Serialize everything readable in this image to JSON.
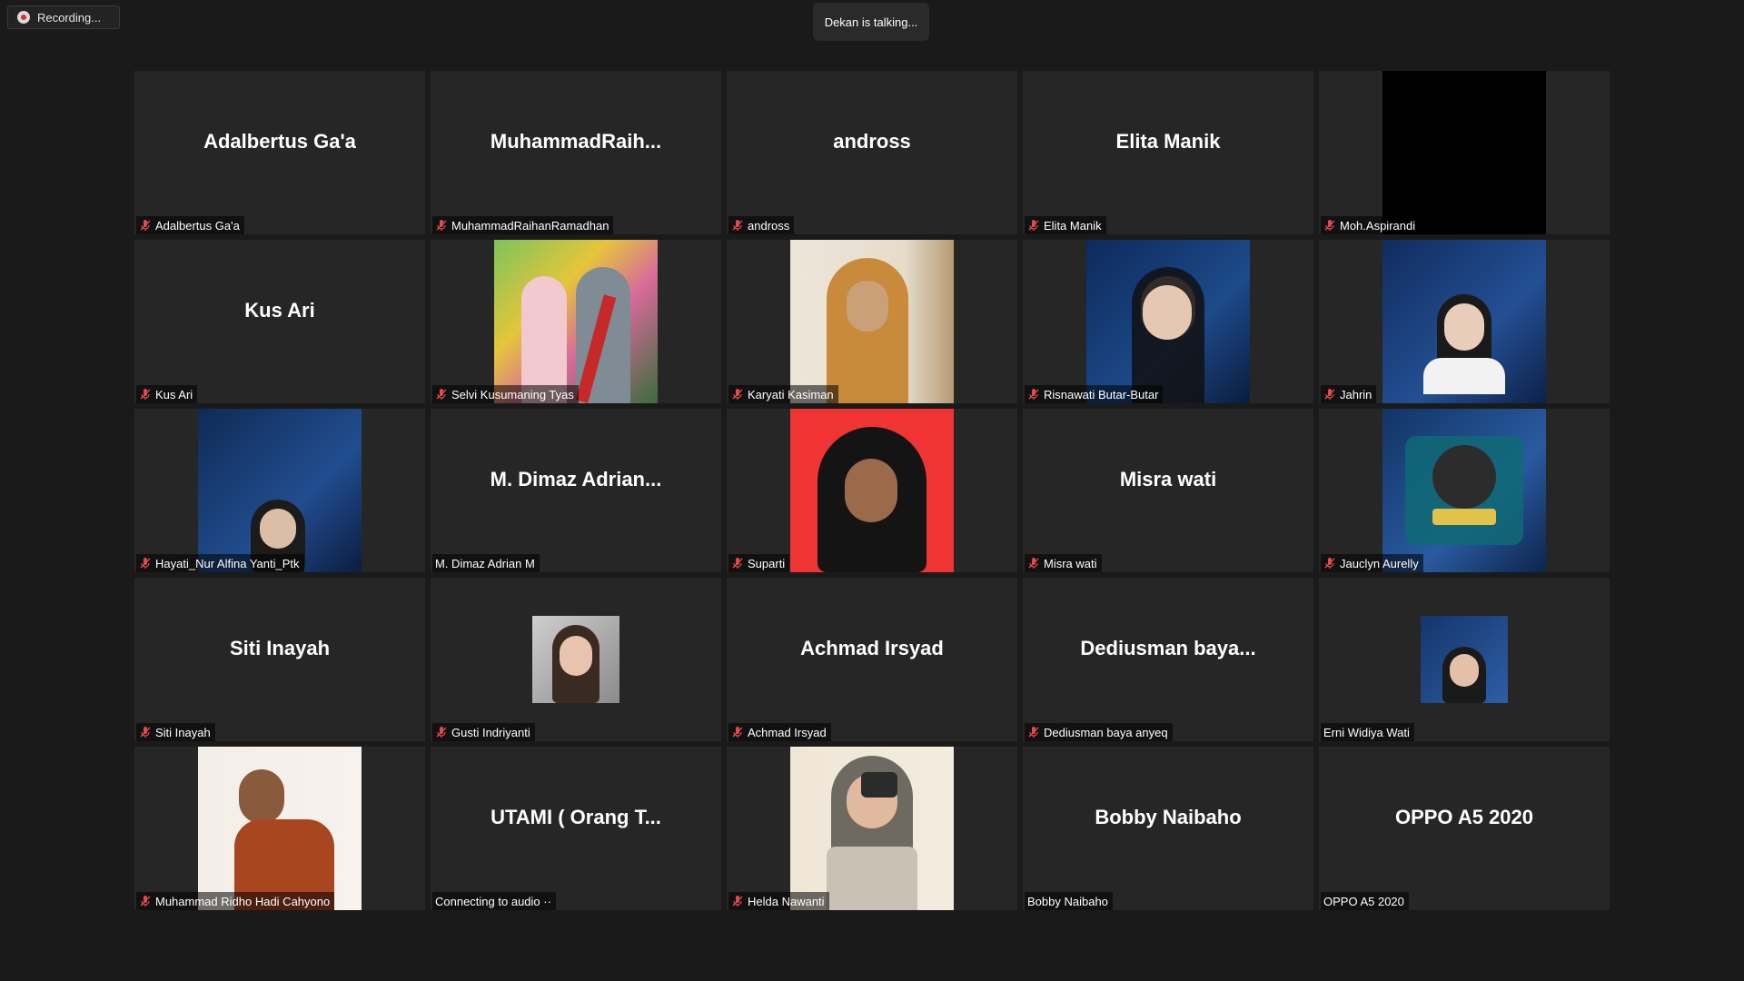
{
  "recording": {
    "label": "Recording..."
  },
  "speaker": {
    "label": "Dekan is talking..."
  },
  "tiles": [
    {
      "big": "Adalbertus Ga'a",
      "label": "Adalbertus Ga'a",
      "muted": true,
      "video": false
    },
    {
      "big": "MuhammadRaih...",
      "label": "MuhammadRaihanRamadhan",
      "muted": true,
      "video": false
    },
    {
      "big": "andross",
      "label": "andross",
      "muted": true,
      "video": false
    },
    {
      "big": "Elita Manik",
      "label": "Elita Manik",
      "muted": true,
      "video": false
    },
    {
      "big": "",
      "label": "Moh.Aspirandi",
      "muted": true,
      "video": true
    },
    {
      "big": "Kus Ari",
      "label": "Kus Ari",
      "muted": true,
      "video": false
    },
    {
      "big": "",
      "label": "Selvi Kusumaning Tyas",
      "muted": true,
      "video": true
    },
    {
      "big": "",
      "label": "Karyati Kasiman",
      "muted": true,
      "video": true
    },
    {
      "big": "",
      "label": "Risnawati Butar-Butar",
      "muted": true,
      "video": true
    },
    {
      "big": "",
      "label": "Jahrin",
      "muted": true,
      "video": true
    },
    {
      "big": "",
      "label": "Hayati_Nur Alfina Yanti_Ptk",
      "muted": true,
      "video": true
    },
    {
      "big": "M. Dimaz Adrian...",
      "label": "M. Dimaz Adrian M",
      "muted": false,
      "video": false
    },
    {
      "big": "",
      "label": "Suparti",
      "muted": true,
      "video": true
    },
    {
      "big": "Misra wati",
      "label": "Misra wati",
      "muted": true,
      "video": false
    },
    {
      "big": "",
      "label": "Jauclyn Aurelly",
      "muted": true,
      "video": true
    },
    {
      "big": "Siti Inayah",
      "label": "Siti Inayah",
      "muted": true,
      "video": false
    },
    {
      "big": "",
      "label": "Gusti Indriyanti",
      "muted": true,
      "video": true
    },
    {
      "big": "Achmad Irsyad",
      "label": "Achmad Irsyad",
      "muted": true,
      "video": false
    },
    {
      "big": "Dediusman  baya...",
      "label": "Dediusman baya anyeq",
      "muted": true,
      "video": false
    },
    {
      "big": "",
      "label": "Erni Widiya Wati",
      "muted": false,
      "video": true
    },
    {
      "big": "",
      "label": "Muhammad Ridho Hadi Cahyono",
      "muted": true,
      "video": true
    },
    {
      "big": "UTAMI ( Orang T...",
      "label": "Connecting to audio ··",
      "muted": false,
      "video": false
    },
    {
      "big": "",
      "label": "Helda Nawanti",
      "muted": true,
      "video": true
    },
    {
      "big": "Bobby Naibaho",
      "label": "Bobby Naibaho",
      "muted": false,
      "video": false
    },
    {
      "big": "OPPO A5 2020",
      "label": "OPPO A5 2020",
      "muted": false,
      "video": false
    }
  ]
}
